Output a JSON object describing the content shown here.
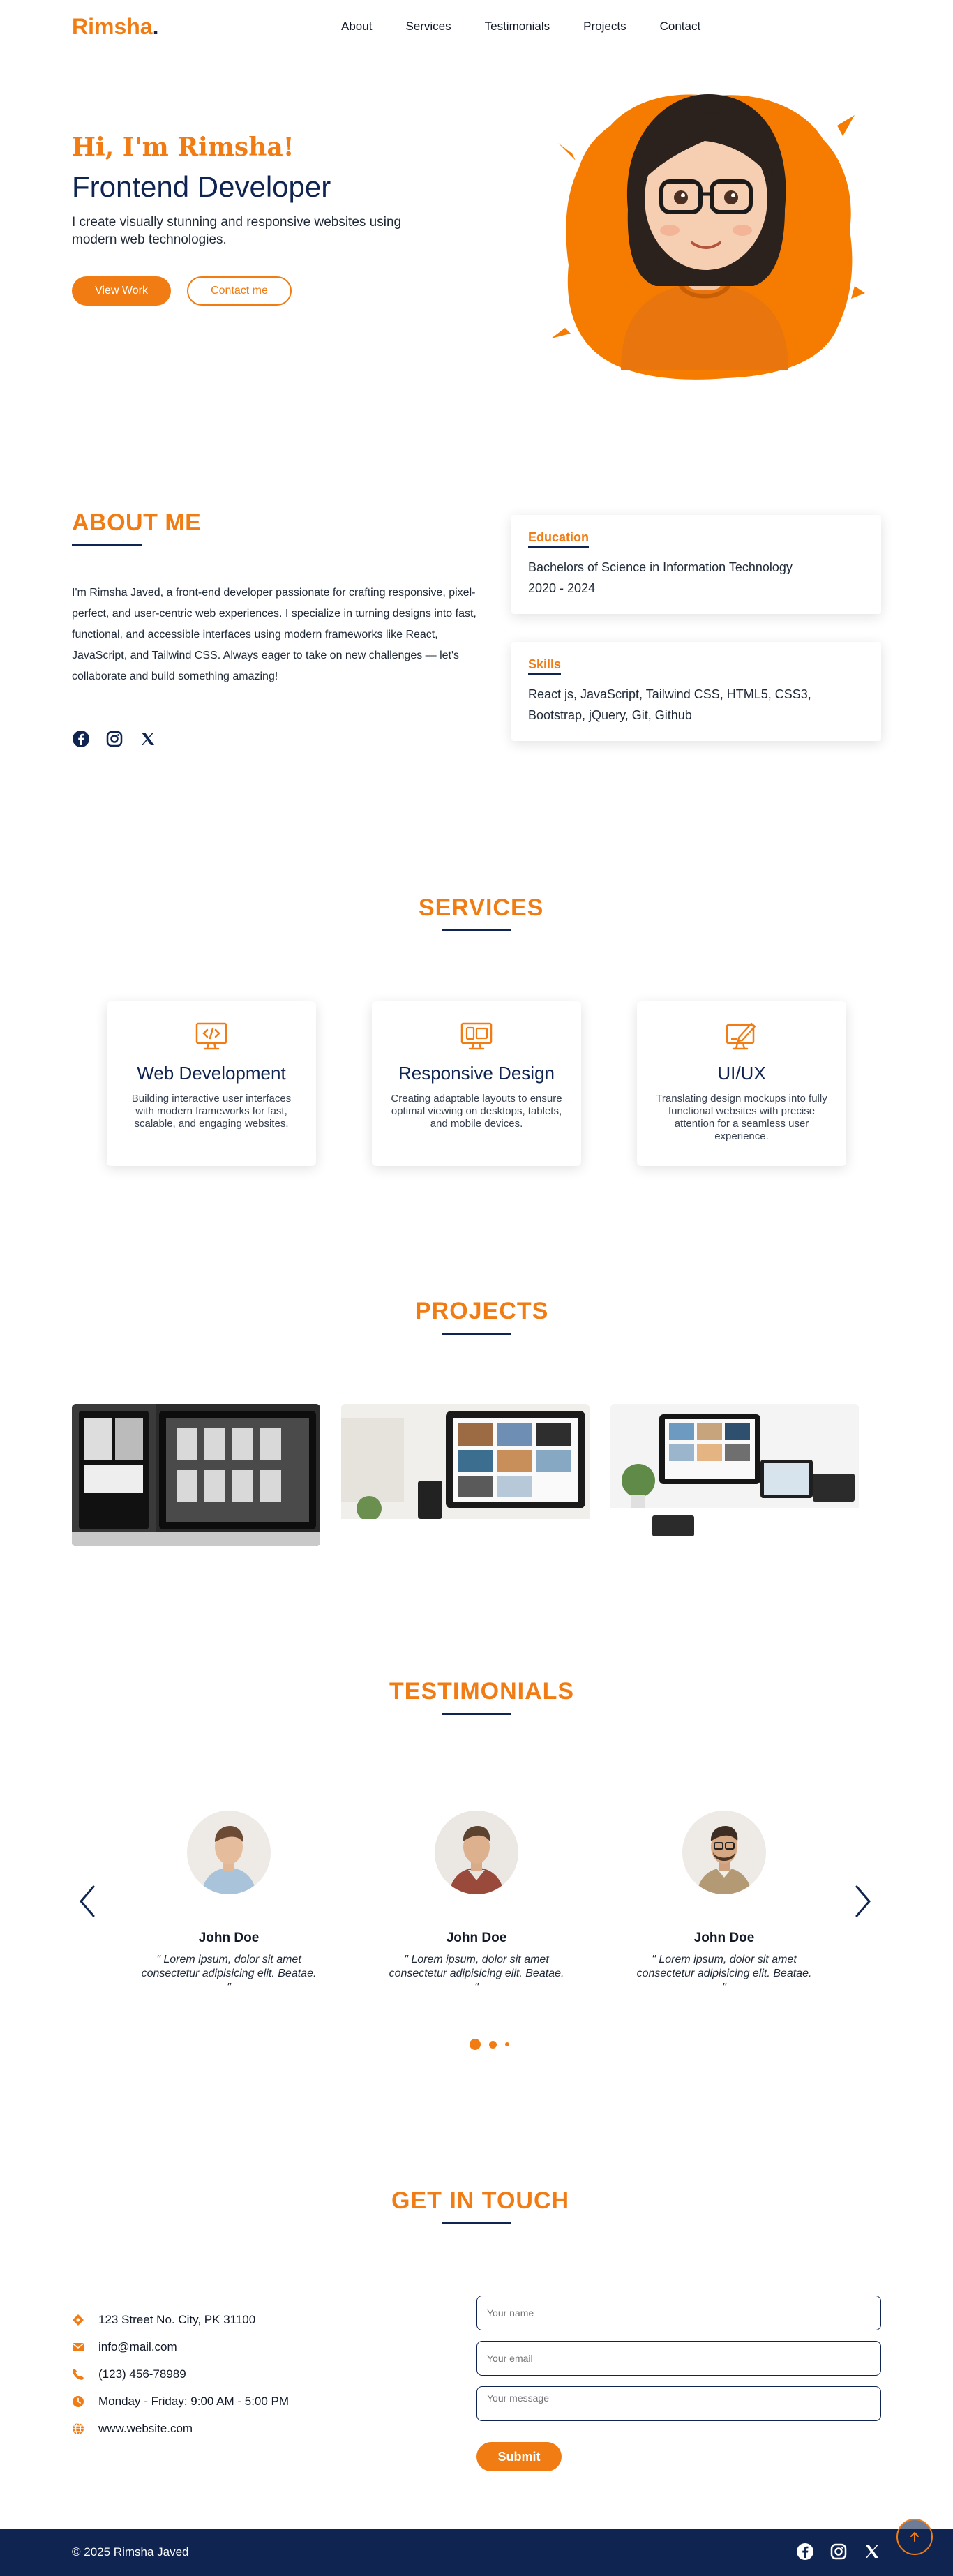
{
  "header": {
    "logo": "Rimsha",
    "logo_dot": ".",
    "nav": [
      "About",
      "Services",
      "Testimonials",
      "Projects",
      "Contact"
    ]
  },
  "hero": {
    "greeting": "Hi, I'm Rimsha!",
    "role": "Frontend Developer",
    "description": "I create visually stunning and responsive websites using modern web technologies.",
    "primary_button": "View Work",
    "secondary_button": "Contact me"
  },
  "about": {
    "title": "ABOUT ME",
    "text": "I'm Rimsha Javed, a front-end developer passionate for crafting responsive, pixel-perfect, and user-centric web experiences. I specialize in turning designs into fast, functional, and accessible interfaces using modern frameworks like React, JavaScript, and Tailwind CSS. Always eager to take on new challenges — let's collaborate and build something amazing!",
    "education": {
      "heading": "Education",
      "degree": "Bachelors of Science in Information Technology",
      "years": "2020 - 2024"
    },
    "skills": {
      "heading": "Skills",
      "list": "React js, JavaScript, Tailwind CSS, HTML5, CSS3, Bootstrap, jQuery, Git, Github"
    }
  },
  "services": {
    "title": "SERVICES",
    "items": [
      {
        "icon": "code-monitor-icon",
        "title": "Web Development",
        "text": "Building interactive user interfaces with modern frameworks for fast, scalable, and engaging websites."
      },
      {
        "icon": "responsive-devices-icon",
        "title": "Responsive Design",
        "text": "Creating adaptable layouts to ensure optimal viewing on desktops, tablets, and mobile devices."
      },
      {
        "icon": "design-monitor-icon",
        "title": "UI/UX",
        "text": "Translating design mockups into fully functional websites with precise attention for a seamless user experience."
      }
    ]
  },
  "projects": {
    "title": "PROJECTS"
  },
  "testimonials": {
    "title": "TESTIMONIALS",
    "items": [
      {
        "name": "John Doe",
        "quote": "\" Lorem ipsum, dolor sit amet consectetur adipisicing elit. Beatae. \""
      },
      {
        "name": "John Doe",
        "quote": "\" Lorem ipsum, dolor sit amet consectetur adipisicing elit. Beatae. \""
      },
      {
        "name": "John Doe",
        "quote": "\" Lorem ipsum, dolor sit amet consectetur adipisicing elit. Beatae. \""
      }
    ]
  },
  "contact": {
    "title": "GET IN TOUCH",
    "address": "123 Street No. City, PK 31100",
    "email": "info@mail.com",
    "phone": "(123) 456-78989",
    "hours": "Monday - Friday: 9:00 AM - 5:00 PM",
    "website": "www.website.com",
    "name_placeholder": "Your name",
    "email_placeholder": "Your email",
    "message_placeholder": "Your message",
    "submit": "Submit"
  },
  "footer": {
    "copyright": "© 2025 Rimsha Javed"
  },
  "colors": {
    "accent": "#f07c13",
    "navy": "#0f2450"
  }
}
